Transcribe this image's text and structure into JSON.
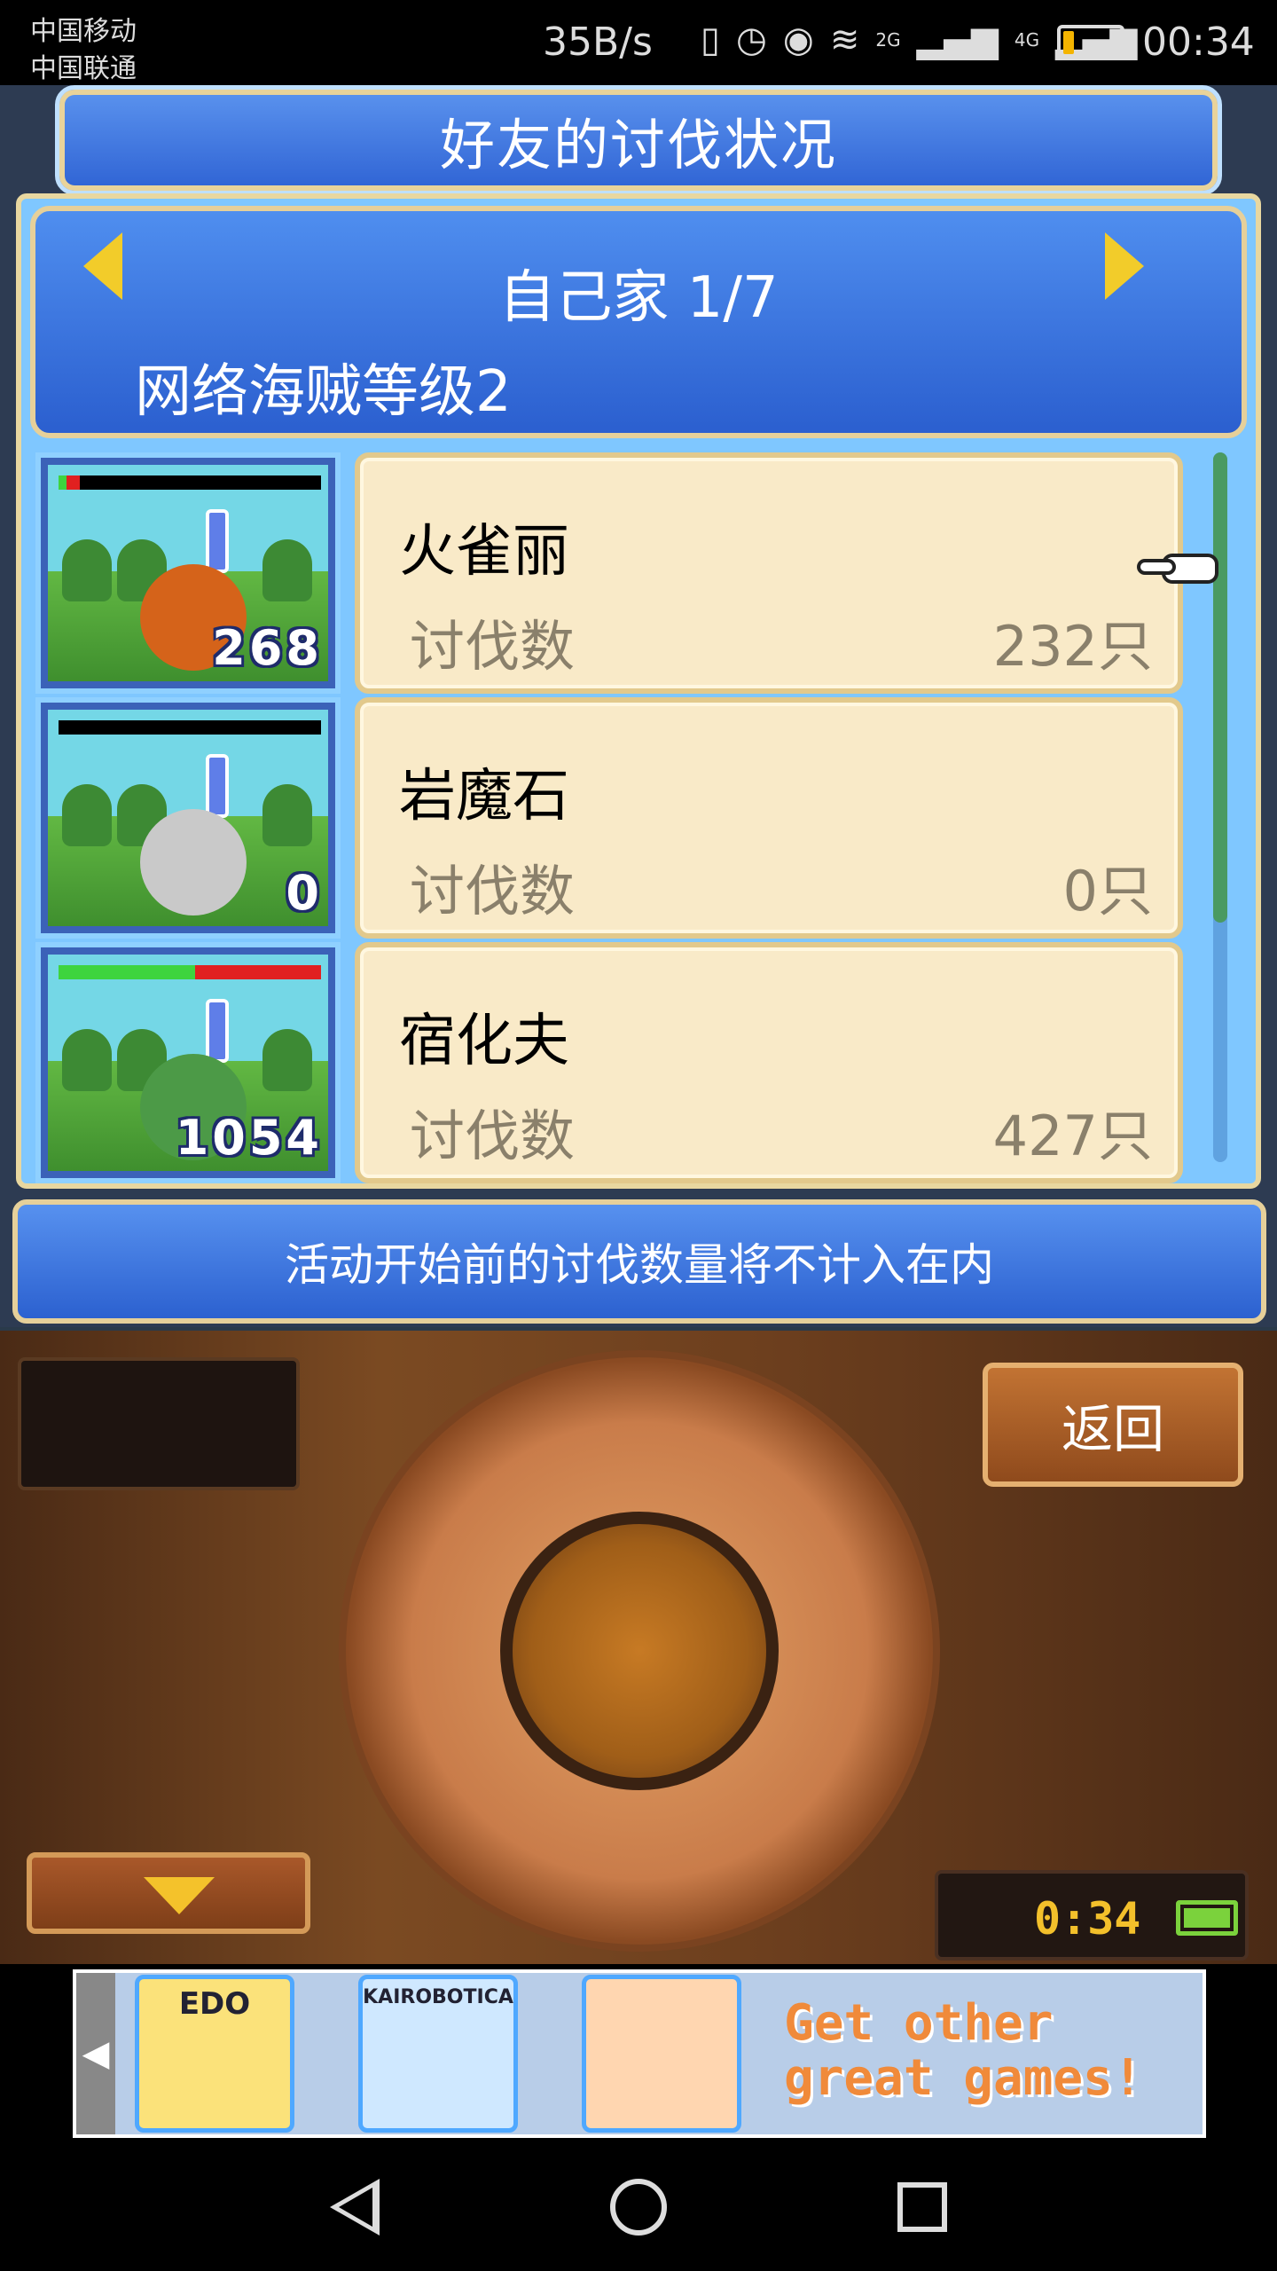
{
  "status_bar": {
    "carrier_1": "中国移动",
    "carrier_2": "中国联通",
    "net_speed": "35B/s",
    "signal_1": "2G",
    "signal_2": "4G",
    "battery_level": 0.2,
    "time": "00:34"
  },
  "title": "好友的讨伐状况",
  "header": {
    "page_label": "自己家 1/7",
    "subtitle": "网络海贼等级2"
  },
  "list": [
    {
      "name": "火雀丽",
      "label": "讨伐数",
      "count": "232只",
      "badge": "268",
      "hp_green": 0.03,
      "hp_red": 0.05,
      "color": "#d5631a"
    },
    {
      "name": "岩魔石",
      "label": "讨伐数",
      "count": "0只",
      "badge": "0",
      "hp_green": 0.0,
      "hp_red": 0.0,
      "color": "#c9c9c9"
    },
    {
      "name": "宿化夫",
      "label": "讨伐数",
      "count": "427只",
      "badge": "1054",
      "hp_green": 0.52,
      "hp_red": 0.48,
      "color": "#4c9a47"
    }
  ],
  "notice": "活动开始前的讨伐数量将不计入在内",
  "console": {
    "back_label": "返回",
    "game_time": "0:34"
  },
  "ad": {
    "tiles": [
      "EDO",
      "KAIROBOTICA",
      ""
    ],
    "get_other": "Get other great games!"
  },
  "colors": {
    "accent_blue": "#2f63d4",
    "gold": "#f2cc2a",
    "card": "#f9eac8"
  }
}
